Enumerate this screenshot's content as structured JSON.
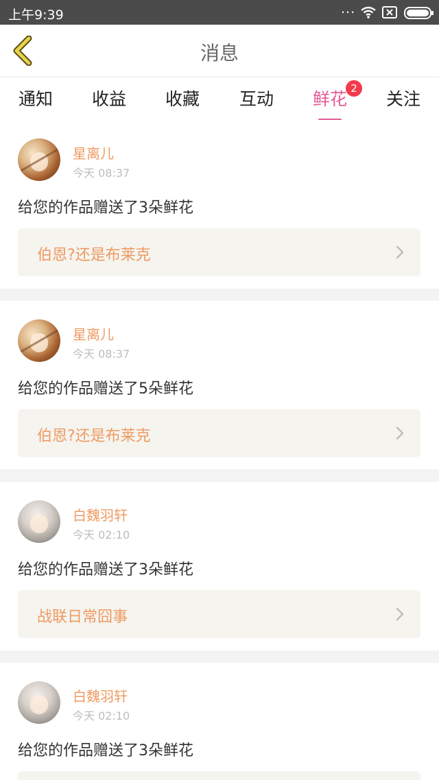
{
  "status_bar": {
    "time": "上午9:39",
    "dots": "...",
    "icons": [
      "wifi-icon",
      "sim-x-icon",
      "battery-icon"
    ]
  },
  "header": {
    "title": "消息",
    "back_icon": "chevron-left-icon",
    "back_color": "#e7d24a"
  },
  "tabs": {
    "items": [
      {
        "label": "通知"
      },
      {
        "label": "收益"
      },
      {
        "label": "收藏"
      },
      {
        "label": "互动"
      },
      {
        "label": "鲜花",
        "active": true,
        "badge": "2"
      },
      {
        "label": "关注"
      }
    ],
    "active_color": "#e35b95",
    "badge_color": "#f23b4c"
  },
  "messages": [
    {
      "username": "星离儿",
      "time": "今天 08:37",
      "text": "给您的作品赠送了3朵鲜花",
      "work_title": "伯恩?还是布莱克"
    },
    {
      "username": "星离儿",
      "time": "今天 08:37",
      "text": "给您的作品赠送了5朵鲜花",
      "work_title": "伯恩?还是布莱克"
    },
    {
      "username": "白魏羽轩",
      "time": "今天 02:10",
      "text": "给您的作品赠送了3朵鲜花",
      "work_title": "战联日常囧事"
    },
    {
      "username": "白魏羽轩",
      "time": "今天 02:10",
      "text": "给您的作品赠送了3朵鲜花",
      "work_title": ""
    }
  ],
  "colors": {
    "accent_orange": "#ef9a62",
    "link_bg": "#f5f4ef",
    "separator": "#f3f3f3"
  }
}
